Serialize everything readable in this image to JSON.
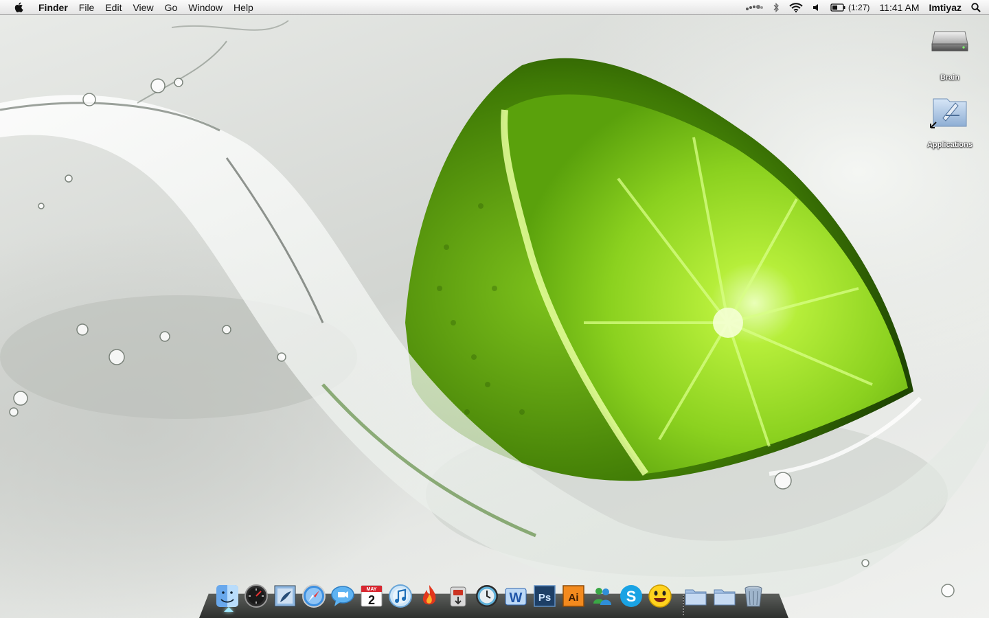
{
  "menubar": {
    "app_name": "Finder",
    "menus": [
      "File",
      "Edit",
      "View",
      "Go",
      "Window",
      "Help"
    ],
    "battery_time": "(1:27)",
    "clock": "11:41 AM",
    "user": "Imtiyaz"
  },
  "desktop_icons": [
    {
      "label": "Brain",
      "icon": "hard-drive-icon"
    },
    {
      "label": "Applications",
      "icon": "applications-folder-alias-icon"
    }
  ],
  "dock": {
    "items": [
      {
        "name": "finder",
        "icon": "finder-icon",
        "running": true
      },
      {
        "name": "dashboard",
        "icon": "dashboard-icon"
      },
      {
        "name": "mail",
        "icon": "mail-icon"
      },
      {
        "name": "safari",
        "icon": "safari-icon"
      },
      {
        "name": "ichat",
        "icon": "ichat-icon"
      },
      {
        "name": "ical",
        "icon": "ical-icon",
        "month": "MAY",
        "day": "2"
      },
      {
        "name": "itunes",
        "icon": "itunes-icon"
      },
      {
        "name": "flame",
        "icon": "flame-app-icon"
      },
      {
        "name": "transmission",
        "icon": "transmission-icon"
      },
      {
        "name": "time-machine",
        "icon": "time-machine-icon"
      },
      {
        "name": "word",
        "icon": "word-icon",
        "text": "W"
      },
      {
        "name": "photoshop",
        "icon": "photoshop-icon",
        "text": "Ps"
      },
      {
        "name": "illustrator",
        "icon": "illustrator-icon",
        "text": "Ai"
      },
      {
        "name": "messenger",
        "icon": "messenger-icon"
      },
      {
        "name": "skype",
        "icon": "skype-icon",
        "text": "S"
      },
      {
        "name": "yahoo-messenger",
        "icon": "yahoo-messenger-icon"
      },
      {
        "name": "documents-stack",
        "icon": "folder-stack-icon"
      },
      {
        "name": "downloads-stack",
        "icon": "folder-stack-icon"
      },
      {
        "name": "trash",
        "icon": "trash-icon"
      }
    ]
  },
  "colors": {
    "lime": "#8fd321",
    "lime_dark": "#3f7a05",
    "menubar": "#ececec",
    "ps_blue": "#1d3f66",
    "ai_orange": "#f38a1e",
    "skype_blue": "#1aa3e4",
    "yahoo_yellow": "#ffd21e"
  }
}
